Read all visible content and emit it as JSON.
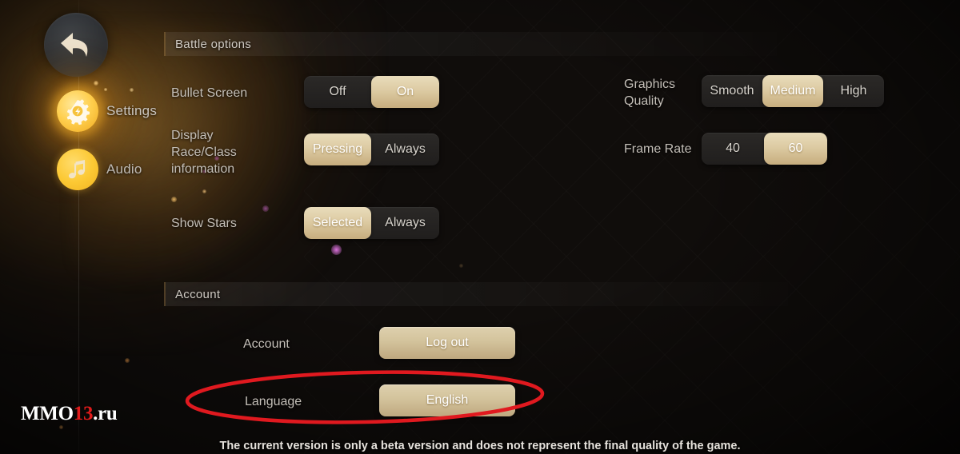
{
  "sidebar": {
    "back_button": {
      "name": "back-button",
      "icon": "back-arrow-icon"
    },
    "items": [
      {
        "label": "Settings",
        "icon": "gear-icon",
        "active": true
      },
      {
        "label": "Audio",
        "icon": "music-note-icon",
        "active": false
      }
    ]
  },
  "sections": [
    {
      "title": "Battle options"
    },
    {
      "title": "Account"
    }
  ],
  "battle_options": {
    "title": "Battle options",
    "rows": [
      {
        "label": "Bullet Screen",
        "options": [
          "Off",
          "On"
        ],
        "selected": "On"
      },
      {
        "label": "Display\nRace/Class\ninformation",
        "label_line1": "Display",
        "label_line2": "Race/Class",
        "label_line3": "information",
        "options": [
          "Pressing",
          "Always"
        ],
        "selected": "Pressing"
      },
      {
        "label": "Show Stars",
        "options": [
          "Selected",
          "Always"
        ],
        "selected": "Selected"
      }
    ],
    "right_rows": [
      {
        "label_line1": "Graphics",
        "label_line2": "Quality",
        "options": [
          "Smooth",
          "Medium",
          "High"
        ],
        "selected": "Medium"
      },
      {
        "label_line1": "Frame Rate",
        "label_line2": "",
        "options": [
          "40",
          "60"
        ],
        "selected": "60"
      }
    ]
  },
  "account_section": {
    "title": "Account",
    "rows": [
      {
        "label": "Account",
        "button": "Log out"
      },
      {
        "label": "Language",
        "button": "English"
      }
    ]
  },
  "annotation": {
    "shape": "ellipse",
    "color": "#e0191f",
    "target": "Language"
  },
  "watermark": {
    "part1": "MMO",
    "part2": "13",
    "part3": ".ru"
  },
  "footer": {
    "note": "The current version is only a beta version and does not represent the final quality of the game."
  },
  "colors": {
    "accent_gold": "#d3c39c",
    "selected_pill": "#ddcba3",
    "icon_gold": "#ffcf4e",
    "annotation_red": "#e0191f",
    "text_primary": "#c4bfb8",
    "background": "#100d0b"
  }
}
